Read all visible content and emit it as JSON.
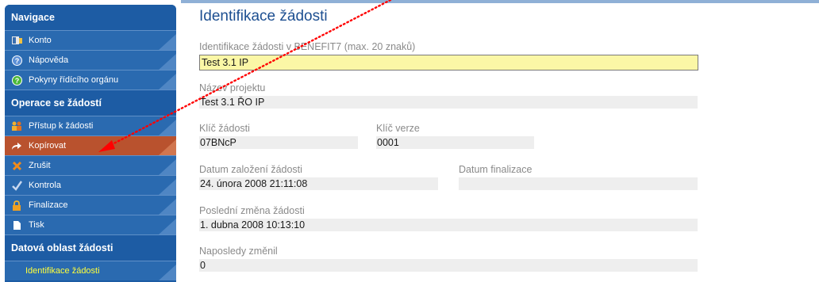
{
  "sidebar": {
    "nav_header": "Navigace",
    "nav_items": [
      {
        "label": "Konto",
        "icon": "account-icon"
      },
      {
        "label": "Nápověda",
        "icon": "help-icon"
      },
      {
        "label": "Pokyny řídícího orgánu",
        "icon": "guidelines-icon"
      }
    ],
    "ops_header": "Operace se žádostí",
    "ops_items": [
      {
        "label": "Přístup k žádosti",
        "icon": "users-icon"
      },
      {
        "label": "Kopírovat",
        "icon": "copy-arrow-icon",
        "active": true
      },
      {
        "label": "Zrušit",
        "icon": "cancel-icon"
      },
      {
        "label": "Kontrola",
        "icon": "checkmark-icon"
      },
      {
        "label": "Finalizace",
        "icon": "lock-icon"
      },
      {
        "label": "Tisk",
        "icon": "print-icon"
      }
    ],
    "data_header": "Datová oblast žádosti",
    "data_items": [
      {
        "label": "Identifikace žádosti"
      }
    ]
  },
  "main": {
    "title": "Identifikace žádosti",
    "fields": {
      "ident": {
        "label": "Identifikace žádosti v BENEFIT7 (max. 20 znaků)",
        "value": "Test 3.1 IP"
      },
      "project_name": {
        "label": "Název projektu",
        "value": "Test 3.1 ŘO IP"
      },
      "key": {
        "label": "Klíč žádosti",
        "value": "07BNcP"
      },
      "version_key": {
        "label": "Klíč verze",
        "value": "0001"
      },
      "created": {
        "label": "Datum založení žádosti",
        "value": "24. února 2008 21:11:08"
      },
      "finalized": {
        "label": "Datum finalizace",
        "value": ""
      },
      "last_change": {
        "label": "Poslední změna žádosti",
        "value": "1. dubna 2008 10:13:10"
      },
      "changed_by": {
        "label": "Naposledy změnil",
        "value": "0"
      }
    }
  },
  "colors": {
    "sidebar": "#1d5ca4",
    "active_item": "#b9522e",
    "input_bg": "#fbf7a6",
    "annotation": "#ff0000"
  }
}
